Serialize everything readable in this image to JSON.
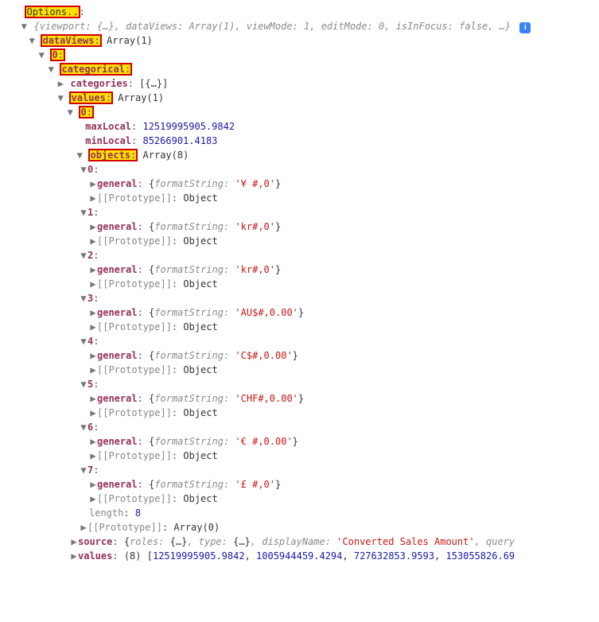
{
  "options_label": "Options..",
  "summary_line": "{viewport: {…}, dataViews: Array(1), viewMode: 1, editMode: 0, isInFocus: false, …}",
  "info_char": "i",
  "dataViews": {
    "key": "dataViews",
    "type": "Array(1)"
  },
  "idx0": "0",
  "categorical": {
    "key": "categorical"
  },
  "categories": {
    "key": "categories",
    "summary": "[{…}]"
  },
  "values": {
    "key": "values",
    "type": "Array(1)"
  },
  "maxLocal": {
    "key": "maxLocal",
    "value": "12519995905.9842"
  },
  "minLocal": {
    "key": "minLocal",
    "value": "85266901.4183"
  },
  "objects": {
    "key": "objects",
    "type": "Array(8)"
  },
  "general_label": "general",
  "proto_label": "[[Prototype]]",
  "proto_obj": "Object",
  "formatString_label": "formatString: ",
  "length_label": "length",
  "length_value": "8",
  "proto_array0": "Array(0)",
  "fmt": {
    "0": "'¥ #,0'",
    "1": "'kr#,0'",
    "2": "'kr#,0'",
    "3": "'AU$#,0.00'",
    "4": "'C$#,0.00'",
    "5": "'CHF#,0.00'",
    "6": "'€ #,0.00'",
    "7": "'£ #,0'"
  },
  "idx": {
    "0": "0",
    "1": "1",
    "2": "2",
    "3": "3",
    "4": "4",
    "5": "5",
    "6": "6",
    "7": "7"
  },
  "source": {
    "key": "source",
    "prefix": "{",
    "roles_k": "roles: ",
    "roles_v": "{…}",
    "type_k": ", type: ",
    "type_v": "{…}",
    "disp_k": ", displayName: ",
    "disp_v": "'Converted Sales Amount'",
    "tail": ", query"
  },
  "values2": {
    "key": "values",
    "count": "(8)",
    "open": "[",
    "v0": "12519995905.9842",
    "v1": "1005944459.4294",
    "v2": "727632853.9593",
    "v3": "153055826.69",
    "sep": ", "
  },
  "colon": ":",
  "braceOpen": "{",
  "braceClose": "}"
}
